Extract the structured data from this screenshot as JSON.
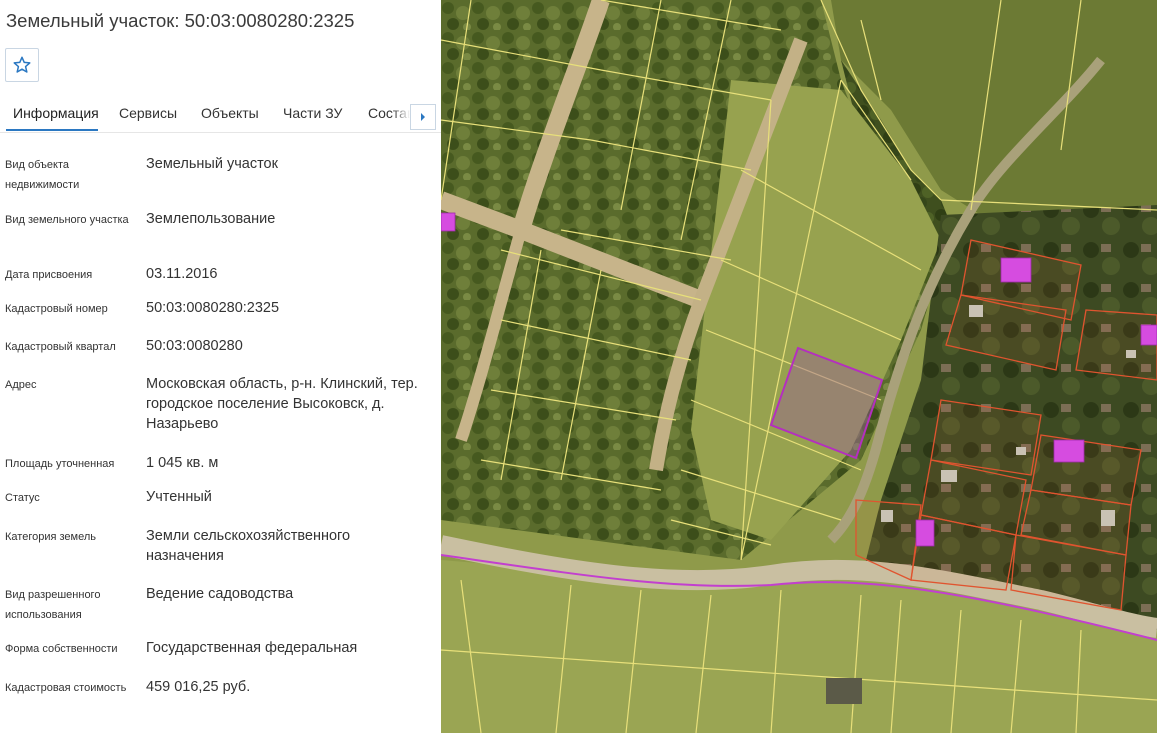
{
  "title": "Земельный участок: 50:03:0080280:2325",
  "favorite": {
    "icon": "star-outline-icon"
  },
  "tabs": [
    {
      "label": "Информация",
      "active": true
    },
    {
      "label": "Сервисы"
    },
    {
      "label": "Объекты"
    },
    {
      "label": "Части ЗУ"
    },
    {
      "label": "Состав"
    }
  ],
  "fields": {
    "object_type": {
      "label": "Вид объекта недвижимости",
      "value": "Земельный участок"
    },
    "plot_type": {
      "label": "Вид земельного участка",
      "value": "Землепользование"
    },
    "assigned_date": {
      "label": "Дата присвоения",
      "value": "03.11.2016"
    },
    "cadastral_number": {
      "label": "Кадастровый номер",
      "value": "50:03:0080280:2325"
    },
    "cadastral_quarter": {
      "label": "Кадастровый квартал",
      "value": "50:03:0080280"
    },
    "address": {
      "label": "Адрес",
      "value": "Московская область, р-н. Клинский, тер. городское поселение Высоковск, д. Назарьево"
    },
    "area": {
      "label": "Площадь уточненная",
      "value": "1 045 кв. м"
    },
    "status": {
      "label": "Статус",
      "value": "Учтенный"
    },
    "land_category": {
      "label": "Категория земель",
      "value": "Земли сельскохозяйственного назначения"
    },
    "permitted_use": {
      "label": "Вид разрешенного использования",
      "value": "Ведение садоводства"
    },
    "ownership": {
      "label": "Форма собственности",
      "value": "Государственная федеральная"
    },
    "cadastral_value": {
      "label": "Кадастровая стоимость",
      "value": "459 016,25 руб."
    }
  },
  "colors": {
    "accent": "#2b78c2",
    "parcel_boundary": "#e8e07a",
    "selected_parcel": "#b42fbf",
    "building": "#d64ce0",
    "built_parcel_boundary": "#e0542f"
  }
}
